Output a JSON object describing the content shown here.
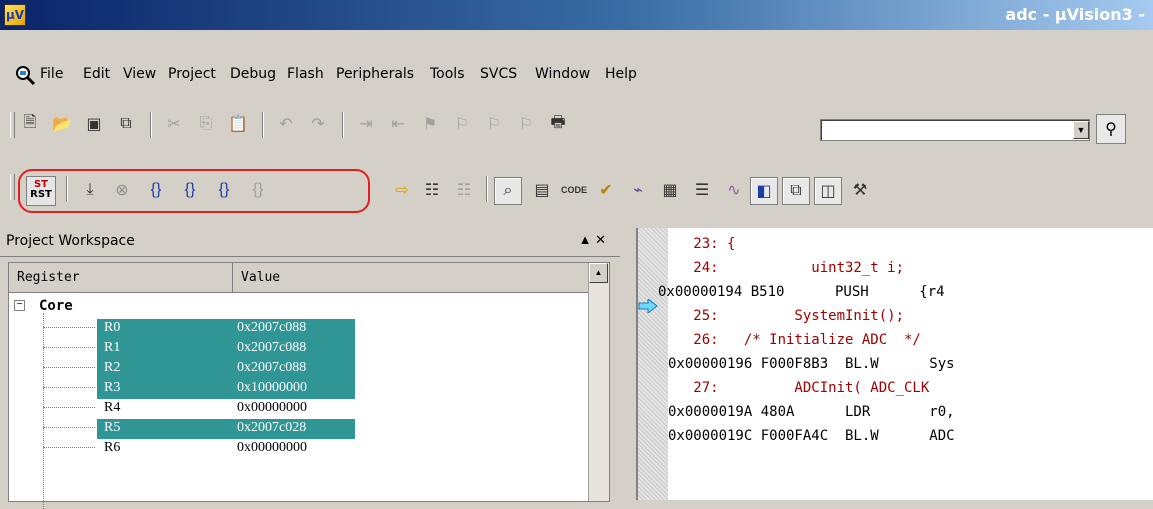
{
  "window": {
    "title": "adc - µVision3 -"
  },
  "menu": [
    "File",
    "Edit",
    "View",
    "Project",
    "Debug",
    "Flash",
    "Peripherals",
    "Tools",
    "SVCS",
    "Window",
    "Help"
  ],
  "toolbar1": {
    "find_combo_value": ""
  },
  "toolbar2": {
    "reset_label_top": "ST",
    "reset_label_bottom": "RST"
  },
  "workspace": {
    "title": "Project Workspace",
    "controls": "▲ ✕",
    "columns": [
      "Register",
      "Value"
    ],
    "group": "Core",
    "registers": [
      {
        "name": "R0",
        "value": "0x2007c088",
        "selected": true
      },
      {
        "name": "R1",
        "value": "0x2007c088",
        "selected": true
      },
      {
        "name": "R2",
        "value": "0x2007c088",
        "selected": true
      },
      {
        "name": "R3",
        "value": "0x10000000",
        "selected": true
      },
      {
        "name": "R4",
        "value": "0x00000000",
        "selected": false
      },
      {
        "name": "R5",
        "value": "0x2007c028",
        "selected": true
      },
      {
        "name": "R6",
        "value": "0x00000000",
        "selected": false
      }
    ]
  },
  "code": [
    {
      "text": "   23: {",
      "kind": "src"
    },
    {
      "text": "   24:           uint32_t i;",
      "kind": "src"
    },
    {
      "text": "0x00000194 B510      PUSH      {r4",
      "kind": "asm"
    },
    {
      "text": "   25:         SystemInit();",
      "kind": "src"
    },
    {
      "text": "   26:   /* Initialize ADC  */",
      "kind": "src"
    },
    {
      "text": "0x00000196 F000F8B3  BL.W      Sys",
      "kind": "asm"
    },
    {
      "text": "   27:         ADCInit( ADC_CLK",
      "kind": "src"
    },
    {
      "text": "0x0000019A 480A      LDR       r0,",
      "kind": "asm"
    },
    {
      "text": "0x0000019C F000FA4C  BL.W      ADC",
      "kind": "asm"
    }
  ],
  "colors": {
    "selection": "#2f9595",
    "source_text": "#a00000",
    "highlight_box": "#e02020"
  }
}
